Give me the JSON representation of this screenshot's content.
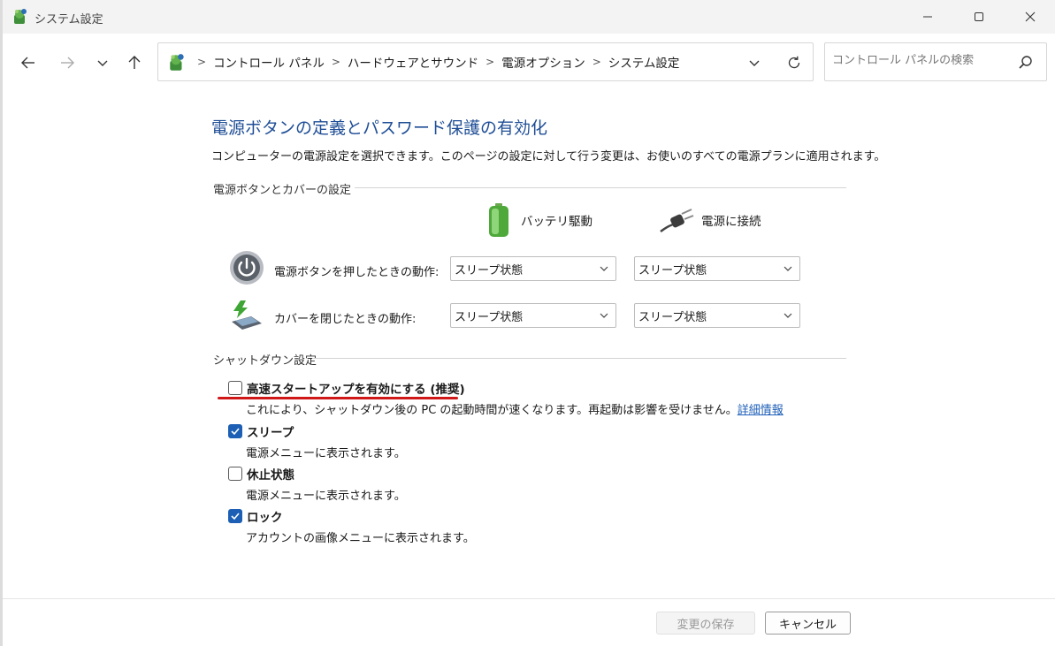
{
  "window": {
    "title": "システム設定",
    "icon": "control-panel-icon"
  },
  "toolbar": {
    "breadcrumbs": [
      "コントロール パネル",
      "ハードウェアとサウンド",
      "電源オプション",
      "システム設定"
    ],
    "search_placeholder": "コントロール パネルの検索"
  },
  "page": {
    "title": "電源ボタンの定義とパスワード保護の有効化",
    "description": "コンピューターの電源設定を選択できます。このページの設定に対して行う変更は、お使いのすべての電源プランに適用されます。"
  },
  "power_section": {
    "heading": "電源ボタンとカバーの設定",
    "columns": {
      "battery": "バッテリ駆動",
      "plugged": "電源に接続"
    },
    "rows": [
      {
        "label": "電源ボタンを押したときの動作:",
        "battery_value": "スリープ状態",
        "plugged_value": "スリープ状態"
      },
      {
        "label": "カバーを閉じたときの動作:",
        "battery_value": "スリープ状態",
        "plugged_value": "スリープ状態"
      }
    ]
  },
  "shutdown_section": {
    "heading": "シャットダウン設定",
    "options": [
      {
        "label": "高速スタートアップを有効にする (推奨)",
        "checked": false,
        "description": "これにより、シャットダウン後の PC の起動時間が速くなります。再起動は影響を受けません。",
        "link": "詳細情報"
      },
      {
        "label": "スリープ",
        "checked": true,
        "description": "電源メニューに表示されます。"
      },
      {
        "label": "休止状態",
        "checked": false,
        "description": "電源メニューに表示されます。"
      },
      {
        "label": "ロック",
        "checked": true,
        "description": "アカウントの画像メニューに表示されます。"
      }
    ]
  },
  "footer": {
    "save_label": "変更の保存",
    "cancel_label": "キャンセル"
  },
  "colors": {
    "title_blue": "#1f4e96",
    "link_blue": "#1f5fb8",
    "checkbox_blue": "#1c5fb4",
    "highlight_red": "#d01818"
  }
}
